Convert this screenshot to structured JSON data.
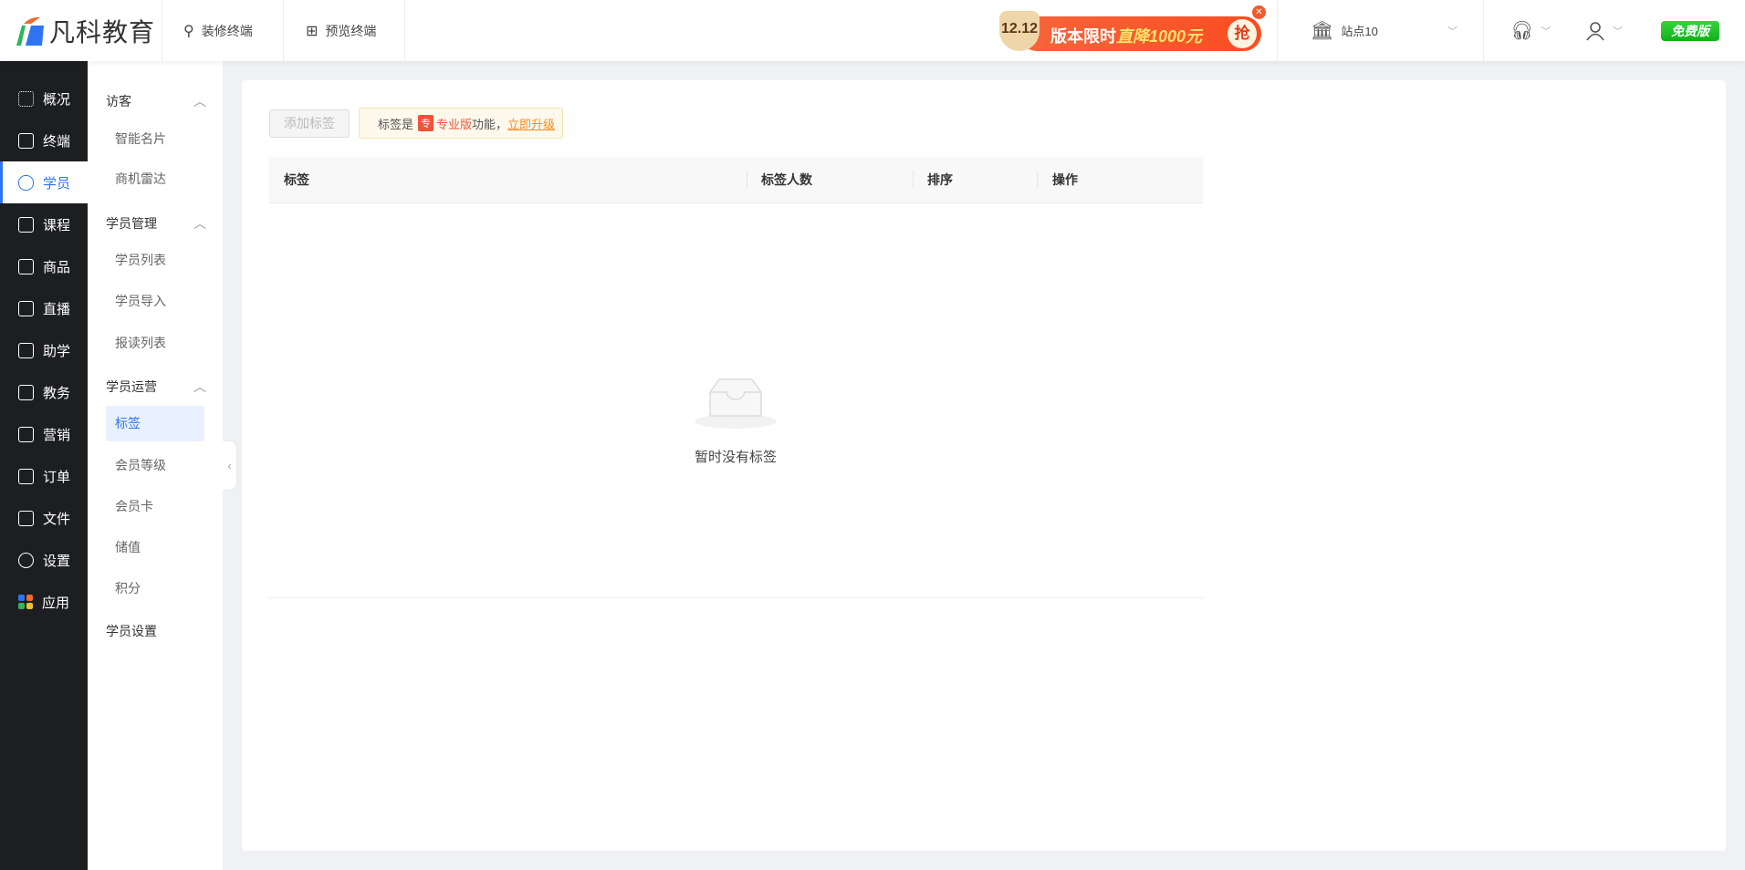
{
  "header": {
    "logo_text": "凡科教育",
    "decorate_label": "装修终端",
    "preview_label": "预览终端",
    "promo": {
      "date": "12.12",
      "text": "版本限时",
      "highlight": "直降1000元",
      "cta": "抢"
    },
    "site_name": "站点10",
    "plan_badge": "免费版"
  },
  "sidebar": {
    "items": [
      {
        "label": "概况",
        "icon": "grid-icon"
      },
      {
        "label": "终端",
        "icon": "store-icon"
      },
      {
        "label": "学员",
        "icon": "users-icon",
        "active": true
      },
      {
        "label": "课程",
        "icon": "course-icon"
      },
      {
        "label": "商品",
        "icon": "bag-icon"
      },
      {
        "label": "直播",
        "icon": "camera-icon"
      },
      {
        "label": "助学",
        "icon": "study-icon"
      },
      {
        "label": "教务",
        "icon": "book-icon"
      },
      {
        "label": "营销",
        "icon": "wallet-icon"
      },
      {
        "label": "订单",
        "icon": "clipboard-icon"
      },
      {
        "label": "文件",
        "icon": "folder-icon"
      },
      {
        "label": "设置",
        "icon": "gear-icon"
      },
      {
        "label": "应用",
        "icon": "apps-icon"
      }
    ]
  },
  "submenu": {
    "g1": "访客",
    "g1_items": [
      "智能名片",
      "商机雷达"
    ],
    "g2": "学员管理",
    "g2_items": [
      "学员列表",
      "学员导入",
      "报读列表"
    ],
    "g3": "学员运营",
    "g3_items": [
      "标签",
      "会员等级",
      "会员卡",
      "储值",
      "积分"
    ],
    "g4": "学员设置"
  },
  "main": {
    "add_button": "添加标签",
    "notice": {
      "prefix": "标签是",
      "badge": "专",
      "pro": "专业版",
      "suffix": "功能，",
      "link": "立即升级"
    },
    "columns": [
      "标签",
      "标签人数",
      "排序",
      "操作"
    ],
    "empty_text": "暂时没有标签"
  }
}
